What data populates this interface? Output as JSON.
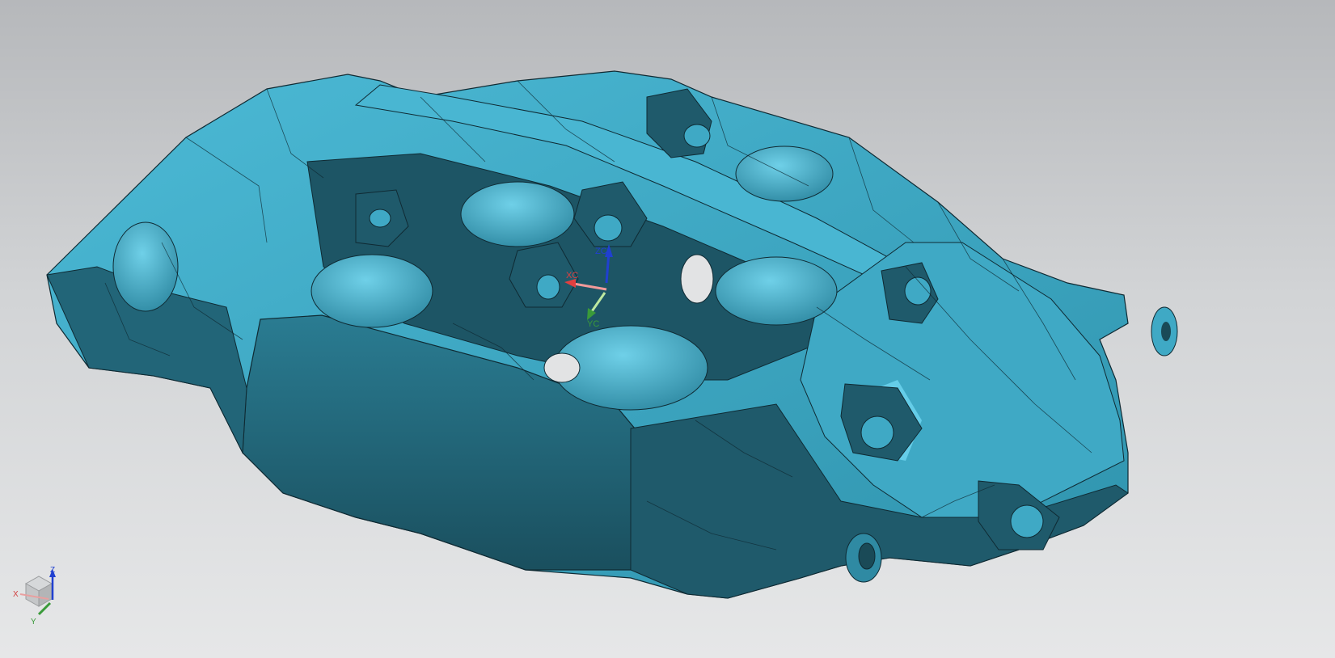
{
  "viewport": {
    "background_top": "#b6b8bb",
    "background_bottom": "#e6e7e8"
  },
  "model": {
    "name": "brake-caliper",
    "color_light": "#42b0cc",
    "color_mid": "#3399b3",
    "color_dark": "#1e5566",
    "color_highlight": "#6fd6f0",
    "edge_color": "#0f2a33"
  },
  "wcs": {
    "x_label": "XC",
    "y_label": "YC",
    "z_label": "ZC",
    "x_color": "#e04040",
    "y_color": "#3a9a3a",
    "z_color": "#2040d0"
  },
  "view_triad": {
    "x_label": "X",
    "y_label": "Y",
    "z_label": "Z",
    "x_color": "#d04040",
    "y_color": "#3a9a3a",
    "z_color": "#2040d0"
  }
}
